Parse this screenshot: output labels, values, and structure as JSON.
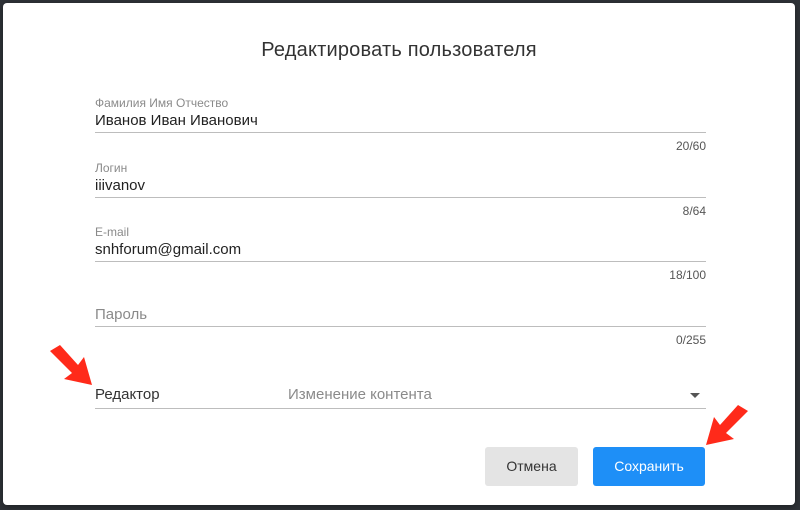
{
  "dialog": {
    "title": "Редактировать пользователя"
  },
  "fields": {
    "fullname": {
      "label": "Фамилия Имя Отчество",
      "value": "Иванов Иван Иванович",
      "counter": "20/60"
    },
    "login": {
      "label": "Логин",
      "value": "iiivanov",
      "counter": "8/64"
    },
    "email": {
      "label": "E-mail",
      "value": "snhforum@gmail.com",
      "counter": "18/100"
    },
    "password": {
      "placeholder": "Пароль",
      "counter": "0/255"
    }
  },
  "role": {
    "label": "Редактор",
    "selected": "Изменение контента"
  },
  "buttons": {
    "cancel": "Отмена",
    "save": "Сохранить"
  },
  "colors": {
    "primary": "#1e8ff7",
    "annotation_arrow": "#ff2a1a"
  },
  "icons": {
    "dropdown": "caret-down-icon",
    "annotations": "red-arrow-icon"
  }
}
